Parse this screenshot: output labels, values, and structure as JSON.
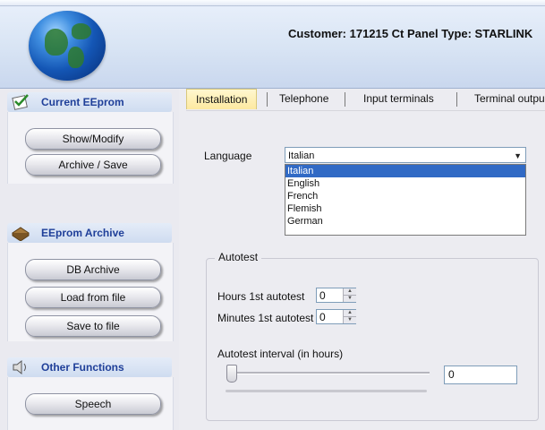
{
  "header": {
    "customer_text": "Customer: 171215 Ct Panel Type: STARLINK"
  },
  "sidebar": {
    "current_eeprom": {
      "title": "Current EEprom",
      "buttons": [
        "Show/Modify",
        "Archive / Save"
      ]
    },
    "eeprom_archive": {
      "title": "EEprom Archive",
      "buttons": [
        "DB Archive",
        "Load from file",
        "Save to file"
      ]
    },
    "other_functions": {
      "title": "Other Functions",
      "buttons": [
        "Speech"
      ]
    }
  },
  "tabs": [
    "Installation",
    "Telephone",
    "Input terminals",
    "Terminal outpu"
  ],
  "active_tab": "Installation",
  "installation": {
    "language_label": "Language",
    "language_value": "Italian",
    "language_options": [
      "Italian",
      "English",
      "French",
      "Flemish",
      "German"
    ],
    "autotest": {
      "title": "Autotest",
      "hours_label": "Hours 1st autotest",
      "hours_value": "0",
      "minutes_label": "Minutes 1st autotest",
      "minutes_value": "0",
      "interval_label": "Autotest interval (in hours)",
      "interval_value": "0",
      "slider_level": 0
    }
  },
  "icons": {
    "globe": "globe-icon",
    "current_eeprom": "checklist-icon",
    "eeprom_archive": "archive-icon",
    "other_functions": "speaker-icon",
    "dropdown_arrow": "chevron-down-icon"
  }
}
